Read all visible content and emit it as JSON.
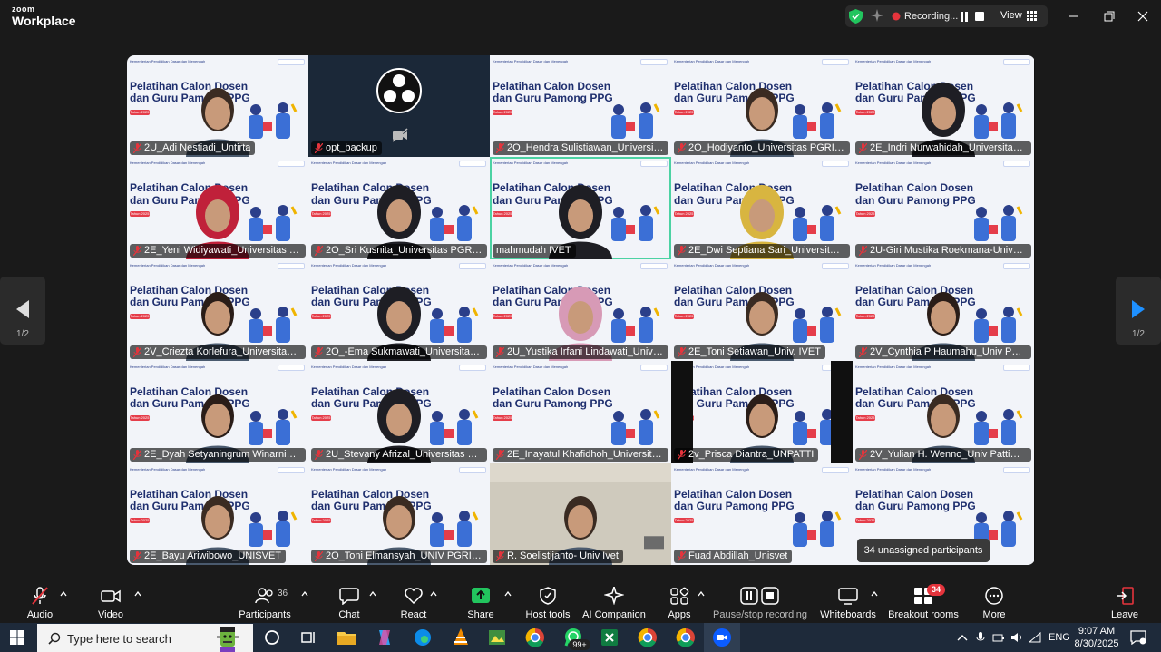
{
  "app": {
    "brand_top": "zoom",
    "brand_bottom": "Workplace"
  },
  "recording": {
    "status_text": "Recording...",
    "view_label": "View"
  },
  "pagination": {
    "left": "1/2",
    "right": "1/2"
  },
  "tiles": [
    {
      "name": "2U_Adi Nestiadi_Untirta",
      "muted": true,
      "kind": "slide",
      "person": "man"
    },
    {
      "name": "opt_backup",
      "muted": true,
      "kind": "obs"
    },
    {
      "name": "2O_Hendra Sulistiawan_Universitas P...",
      "muted": true,
      "kind": "slide"
    },
    {
      "name": "2O_Hodiyanto_Universitas PGRI Pont...",
      "muted": true,
      "kind": "slide",
      "person": "man"
    },
    {
      "name": "2E_Indri Nurwahidah_Universitas Ivet",
      "muted": true,
      "kind": "slide",
      "person": "hijab"
    },
    {
      "name": "2E_Yeni Widiyawati_Universitas Ivet",
      "muted": true,
      "kind": "slide",
      "person": "hijab-red"
    },
    {
      "name": "2O_Sri Kusnita_Universitas PGRI Pon...",
      "muted": true,
      "kind": "slide",
      "person": "hijab"
    },
    {
      "name": "mahmudah IVET",
      "muted": false,
      "kind": "slide",
      "person": "hijab",
      "active": true
    },
    {
      "name": "2E_Dwi Septiana Sari_Universitas Ivet",
      "muted": true,
      "kind": "slide",
      "person": "hijab-yellow"
    },
    {
      "name": "2U-Giri Mustika Roekmana-Universit...",
      "muted": true,
      "kind": "slide"
    },
    {
      "name": "2V_Criezta Korlefura_Universitas Patt...",
      "muted": true,
      "kind": "slide",
      "person": "woman"
    },
    {
      "name": "2O_-Ema Sukmawati_Universitas PG...",
      "muted": true,
      "kind": "slide",
      "person": "hijab"
    },
    {
      "name": "2U_Yustika Irfani Lindawati_Universit...",
      "muted": true,
      "kind": "slide",
      "person": "hijab-pink"
    },
    {
      "name": "2E_Toni Setiawan_Univ. IVET",
      "muted": true,
      "kind": "slide",
      "person": "man"
    },
    {
      "name": "2V_Cynthia P Haumahu_Univ Pattimura",
      "muted": true,
      "kind": "slide",
      "person": "woman"
    },
    {
      "name": "2E_Dyah Setyaningrum Winarni_Uni...",
      "muted": true,
      "kind": "slide",
      "person": "woman"
    },
    {
      "name": "2U_Stevany Afrizal_Universitas Sulta...",
      "muted": true,
      "kind": "slide",
      "person": "hijab"
    },
    {
      "name": "2E_Inayatul Khafidhoh_Universitas Ivet",
      "muted": true,
      "kind": "slide"
    },
    {
      "name": "2v_Prisca Diantra_UNPATTI",
      "muted": true,
      "kind": "slide",
      "person": "woman",
      "bars": true
    },
    {
      "name": "2V_Yulian H. Wenno_Univ Pattimura",
      "muted": true,
      "kind": "slide",
      "person": "man"
    },
    {
      "name": "2E_Bayu Ariwibowo_UNISVET",
      "muted": true,
      "kind": "slide",
      "person": "man"
    },
    {
      "name": "2O_Toni Elmansyah_UNIV PGRI Ponti...",
      "muted": true,
      "kind": "slide",
      "person": "man"
    },
    {
      "name": "R. Soelistijanto- Univ Ivet",
      "muted": true,
      "kind": "photo",
      "person": "man"
    },
    {
      "name": "Fuad Abdillah_Unisvet",
      "muted": true,
      "kind": "slide"
    },
    {
      "name": "",
      "muted": false,
      "kind": "slide"
    }
  ],
  "slide": {
    "header": "Kementerian Pendidikan Dasar dan Menengah",
    "title": "Pelatihan Calon Dosen dan Guru Pamong PPG",
    "year": "Tahun 2025"
  },
  "tooltip": "34 unassigned participants",
  "toolbar": {
    "audio": "Audio",
    "video": "Video",
    "participants": "Participants",
    "participants_count": "36",
    "chat": "Chat",
    "react": "React",
    "share": "Share",
    "host_tools": "Host tools",
    "ai_companion": "AI Companion",
    "apps": "Apps",
    "pause_stop_recording": "Pause/stop recording",
    "whiteboards": "Whiteboards",
    "breakout_rooms": "Breakout rooms",
    "breakout_badge": "34",
    "more": "More",
    "leave": "Leave"
  },
  "taskbar": {
    "search_placeholder": "Type here to search",
    "whatsapp_badge": "99+",
    "language": "ENG",
    "time": "9:07 AM",
    "date": "8/30/2025"
  },
  "colors": {
    "accent_green": "#4cd2a3",
    "recording_red": "#e5343c",
    "share_green": "#22c55e"
  }
}
